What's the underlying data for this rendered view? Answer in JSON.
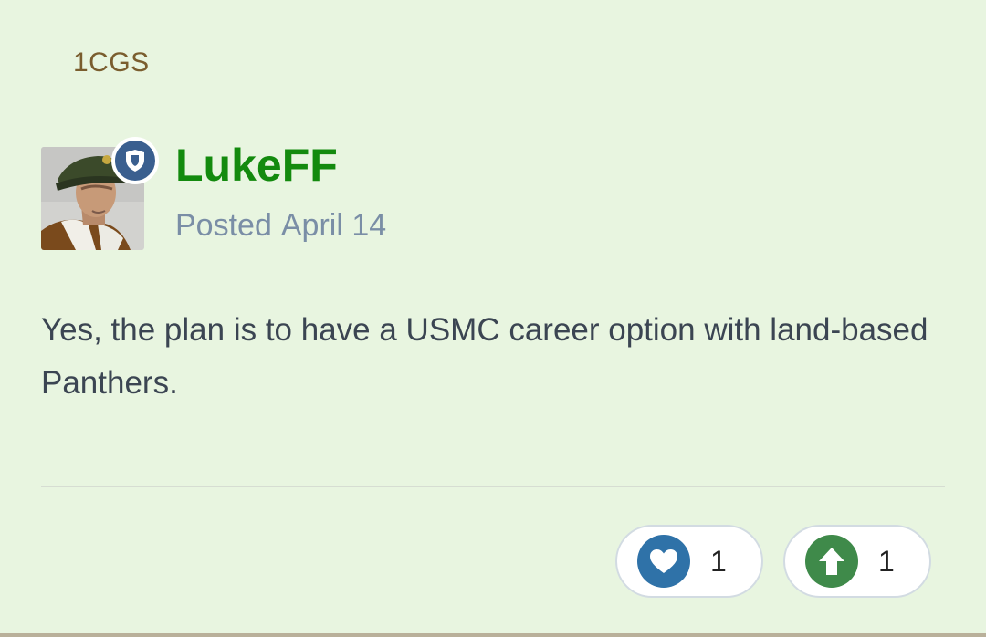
{
  "post": {
    "group_tag": "1CGS",
    "author": {
      "name": "LukeFF",
      "avatar_icon": "soldier-avatar",
      "badge_icon": "shield-icon",
      "badge_color": "#3a5f8f",
      "name_color": "#138a0e"
    },
    "posted_label": "Posted",
    "posted_date": "April 14",
    "body": "Yes, the plan is to have a USMC career option with land-based Panthers.",
    "reactions": [
      {
        "icon": "heart-icon",
        "count": "1",
        "color": "#2f72a8"
      },
      {
        "icon": "arrow-up-icon",
        "count": "1",
        "color": "#3f8a4a"
      }
    ]
  }
}
